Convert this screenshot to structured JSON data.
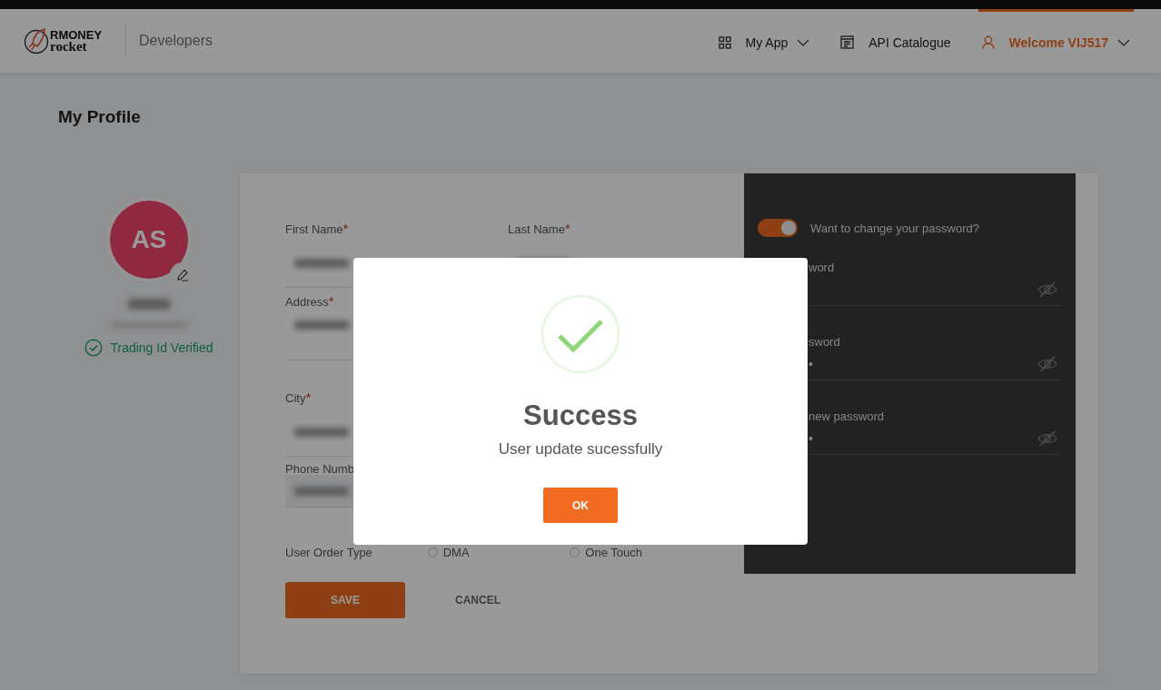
{
  "header": {
    "logo": {
      "line1": "RMONEY",
      "line2": "rocket"
    },
    "section": "Developers",
    "nav": [
      {
        "label": "My App",
        "dropdown": true,
        "selected": false
      },
      {
        "label": "API Catalogue",
        "dropdown": false,
        "selected": false
      },
      {
        "label": "Welcome VIJ517",
        "dropdown": true,
        "selected": true
      }
    ]
  },
  "page_title": "My Profile",
  "profile": {
    "initials": "AS",
    "verified": true,
    "verified_label": "Trading Id Verified"
  },
  "form": {
    "rows": [
      [
        {
          "label": "First Name",
          "mark": "*"
        },
        {
          "label": "Last Name",
          "mark": "*"
        }
      ],
      [
        {
          "label": "Address",
          "mark": "*",
          "kind": "textarea"
        }
      ],
      [
        {
          "label": "City",
          "mark": "*"
        }
      ],
      [
        {
          "label": "Phone Numb",
          "kind": "filled"
        }
      ]
    ],
    "order_type": {
      "label": "User Order Type",
      "options": [
        {
          "label": "DMA",
          "selected": false
        },
        {
          "label": "One Touch",
          "selected": false
        }
      ]
    },
    "buttons": [
      {
        "label": "SAVE",
        "kind": "primary"
      },
      {
        "label": "CANCEL",
        "kind": "text"
      }
    ]
  },
  "password_panel": {
    "toggle": {
      "label": "Want to change your password?",
      "on": true
    },
    "fields": [
      {
        "label": "word"
      },
      {
        "label": "sword",
        "value": "•"
      },
      {
        "label": "new password",
        "value": "•"
      }
    ]
  },
  "dialog": {
    "title": "Success",
    "message": "User update sucessfully",
    "button": "OK"
  }
}
